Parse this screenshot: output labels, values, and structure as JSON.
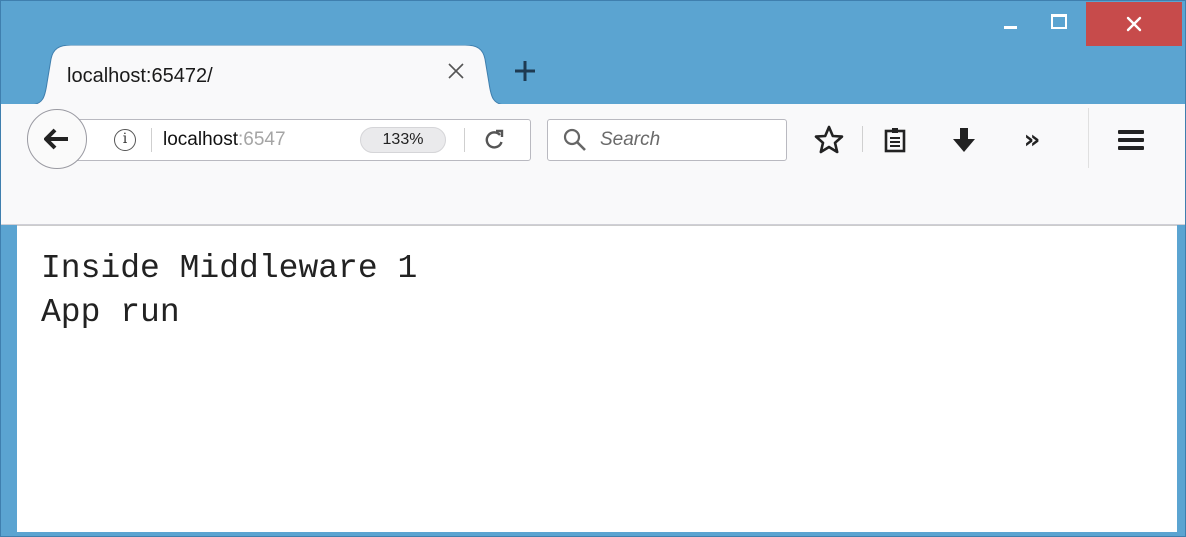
{
  "window": {
    "controls": {
      "minimize_icon": "minimize-icon",
      "maximize_icon": "maximize-icon",
      "close_icon": "close-icon"
    },
    "colors": {
      "frame": "#5ba4d1",
      "close": "#c74b4b",
      "toolbar": "#f9f9fa"
    }
  },
  "tab": {
    "title": "localhost:65472/",
    "close_glyph": "×"
  },
  "newtab": {
    "glyph": "+"
  },
  "urlbar": {
    "host": "localhost",
    "rest": ":6547",
    "zoom": "133%"
  },
  "search": {
    "placeholder": "Search"
  },
  "toolbar": {
    "icons": [
      "star-icon",
      "reading-list-icon",
      "download-icon",
      "overflow-icon",
      "menu-icon"
    ],
    "overflow_glyph": "»"
  },
  "page": {
    "lines": [
      "Inside Middleware 1",
      "App run"
    ]
  }
}
